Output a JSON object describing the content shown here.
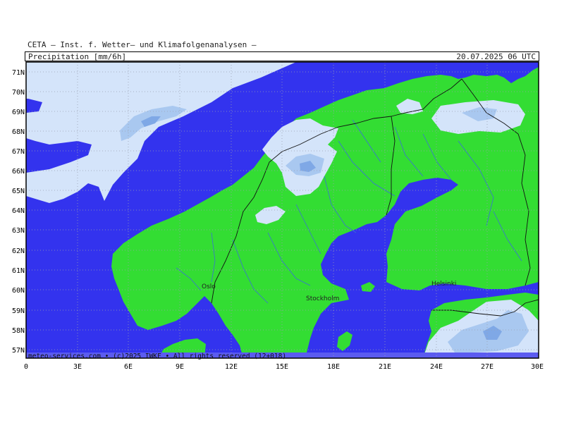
{
  "header": {
    "provider": "CETA – Inst. f. Wetter– und Klimafolgenanalysen –",
    "parameter": "Precipitation [mm/6h]",
    "datetime": "20.07.2025 06 UTC"
  },
  "lat_labels": [
    "71N",
    "70N",
    "69N",
    "68N",
    "67N",
    "66N",
    "65N",
    "64N",
    "63N",
    "62N",
    "61N",
    "60N",
    "59N",
    "58N",
    "57N"
  ],
  "lon_labels": [
    "0",
    "3E",
    "6E",
    "9E",
    "12E",
    "15E",
    "18E",
    "21E",
    "24E",
    "27E",
    "30E"
  ],
  "cities": [
    "Oslo",
    "Stockholm",
    "Helsinki"
  ],
  "footer": {
    "credit": "meteo-services.com • (c)2025 IWKF • All rights reserved (12+018)"
  },
  "colors": {
    "sea": "#3333ee",
    "land": "#33dd33",
    "precip_light": "#d4e4fa",
    "precip_medium": "#a9c8f0",
    "precip_heavy": "#7fa8e6",
    "rivers": "#3a6fd8",
    "borders": "#111111",
    "footer_band": "#5b5bf0"
  }
}
